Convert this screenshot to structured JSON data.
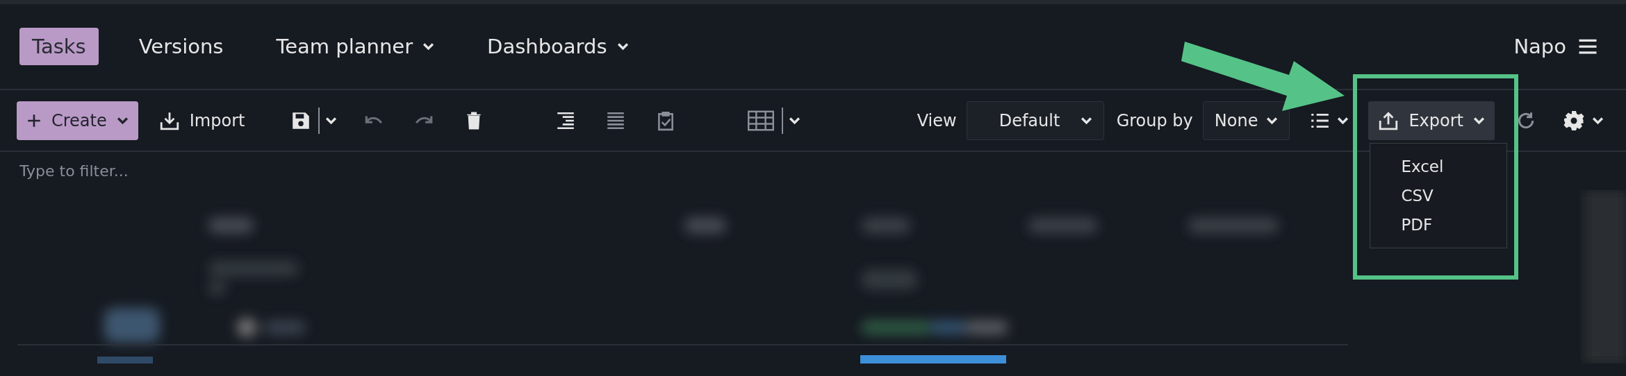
{
  "nav": {
    "tabs": [
      {
        "label": "Tasks",
        "selected": true,
        "caret": false
      },
      {
        "label": "Versions",
        "selected": false,
        "caret": false
      },
      {
        "label": "Team planner",
        "selected": false,
        "caret": true
      },
      {
        "label": "Dashboards",
        "selected": false,
        "caret": true
      }
    ],
    "user": {
      "name": "Napo"
    }
  },
  "toolbar": {
    "create": {
      "label": "Create"
    },
    "import": {
      "label": "Import"
    },
    "view": {
      "label": "View",
      "value": "Default"
    },
    "group_by": {
      "label": "Group by",
      "value": "None"
    },
    "export": {
      "label": "Export",
      "expanded": true,
      "menu": [
        "Excel",
        "CSV",
        "PDF"
      ]
    }
  },
  "filter": {
    "placeholder": "Type to filter..."
  }
}
